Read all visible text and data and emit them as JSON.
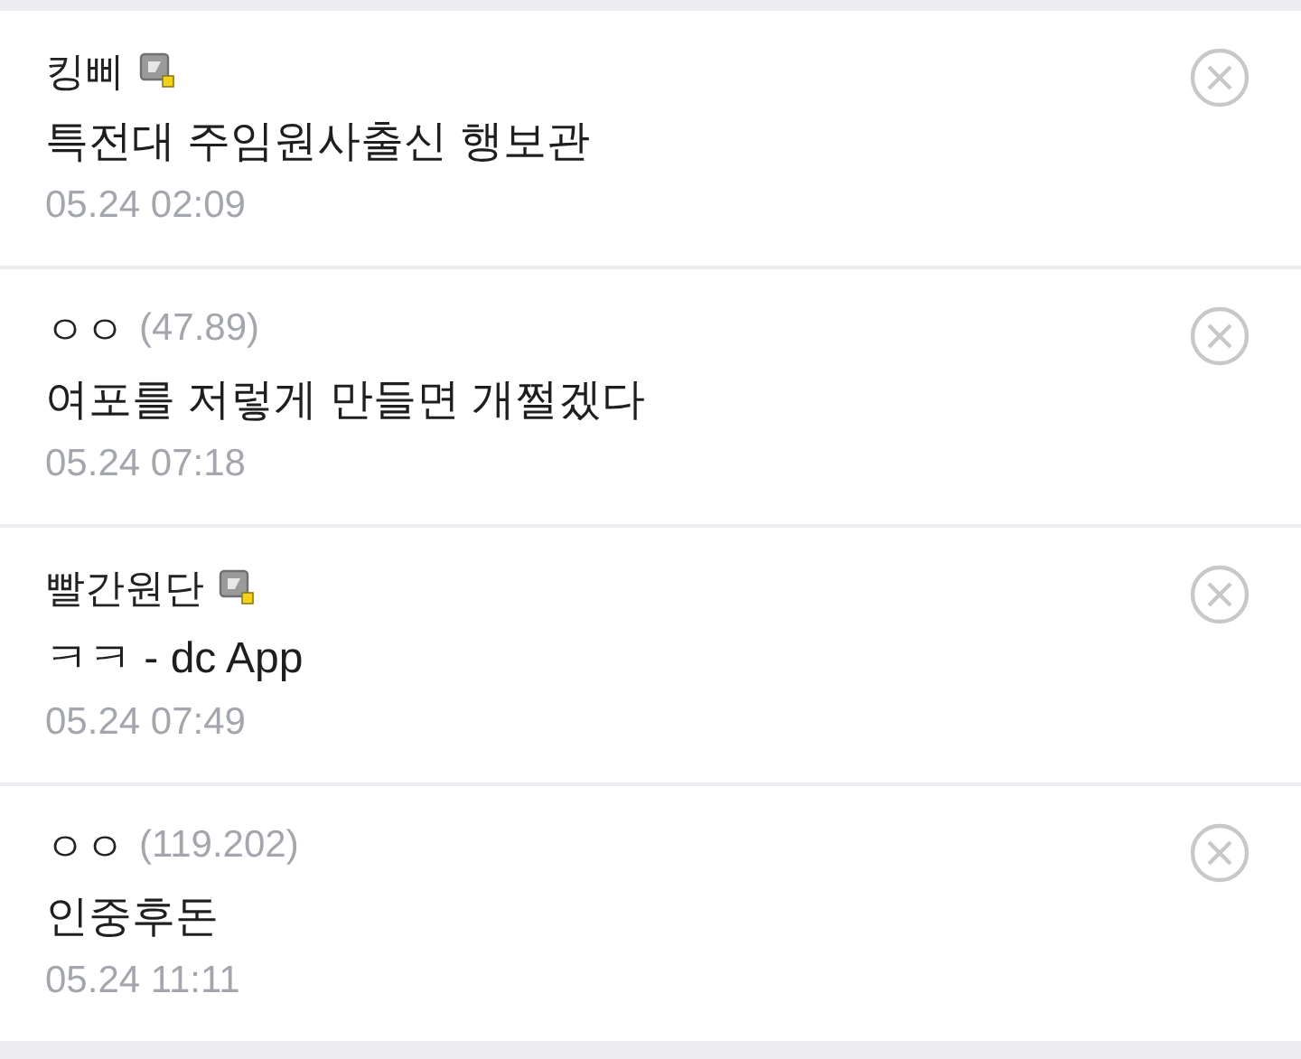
{
  "comments": [
    {
      "kind": "member",
      "author": "킹삐",
      "text": "특전대 주임원사출신 행보관",
      "time": "05.24 02:09"
    },
    {
      "kind": "guest",
      "author": "ㅇㅇ",
      "ip": "(47.89)",
      "text": "여포를 저렇게 만들면 개쩔겠다",
      "time": "05.24 07:18"
    },
    {
      "kind": "member",
      "author": "빨간원단",
      "text": "ㅋㅋ - dc App",
      "time": "05.24 07:49"
    },
    {
      "kind": "guest",
      "author": "ㅇㅇ",
      "ip": "(119.202)",
      "text": "인중후돈",
      "time": "05.24 11:11"
    }
  ]
}
